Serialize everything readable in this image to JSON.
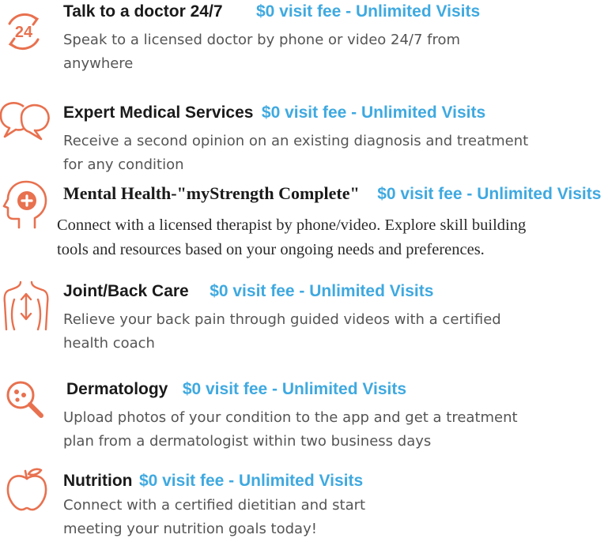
{
  "colors": {
    "icon": "#e8714f",
    "accent": "#3fa9e0",
    "title": "#1a1a1a",
    "text": "#555555"
  },
  "services": [
    {
      "icon": "clock-24-icon",
      "title": "Talk to a doctor 24/7",
      "fee": "$0 visit fee - Unlimited Visits",
      "desc_lines": [
        "Speak to a licensed doctor by phone or video 24/7 from",
        "anywhere"
      ]
    },
    {
      "icon": "speech-bubbles-icon",
      "title": "Expert Medical Services",
      "fee": "$0 visit fee - Unlimited Visits",
      "desc_lines": [
        "Receive a second opinion on an existing diagnosis and treatment",
        "for any condition"
      ]
    },
    {
      "icon": "head-plus-icon",
      "title": "Mental Health-\"myStrength Complete\"",
      "fee": "$0 visit fee - Unlimited Visits",
      "desc_lines": [
        "Connect with a licensed therapist by phone/video. Explore skill building",
        "tools and resources based on your ongoing needs and preferences."
      ]
    },
    {
      "icon": "back-spine-icon",
      "title": "Joint/Back Care",
      "fee": "$0 visit fee - Unlimited Visits",
      "desc_lines": [
        "Relieve your back pain through guided videos with a certified",
        "health coach"
      ]
    },
    {
      "icon": "magnifier-icon",
      "title": "Dermatology",
      "fee": "$0 visit fee - Unlimited Visits",
      "desc_lines": [
        "Upload photos of your condition to the app and get a treatment",
        "plan from a dermatologist within two business days"
      ]
    },
    {
      "icon": "apple-icon",
      "title": "Nutrition",
      "fee": "$0 visit fee - Unlimited Visits",
      "desc_lines": [
        "Connect with a certified dietitian and start",
        "meeting your nutrition goals today!"
      ]
    }
  ]
}
